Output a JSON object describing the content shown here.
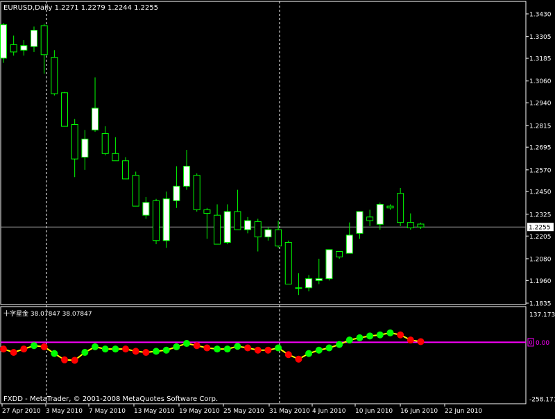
{
  "colors": {
    "background": "#000000",
    "frame": "#ffffff",
    "bull_candle": "#ffffff",
    "bear_candle": "#000000",
    "wick": "#00ff00",
    "indicator_line": "#ffff00",
    "dot_up": "#00ff00",
    "dot_down": "#ff0000",
    "zero_line": "#ff00ff",
    "price_line": "#a0a0a0",
    "badge_bg": "#ffffff",
    "badge_text": "#000000"
  },
  "price_panel": {
    "header": "EURUSD,Daily  1.2271 1.2279 1.2244 1.2255",
    "axis_labels": [
      "1.3430",
      "1.3305",
      "1.3185",
      "1.3060",
      "1.2940",
      "1.2815",
      "1.2695",
      "1.2570",
      "1.2450",
      "1.2325",
      "1.2205",
      "1.2080",
      "1.1960",
      "1.1835"
    ],
    "current_price_label": "1.2255"
  },
  "indicator_panel": {
    "header": "十字星金 38.07847 38.07847",
    "axis_labels": [
      "137.1737",
      "0.00",
      "-258.171"
    ],
    "zero_badge": "0"
  },
  "footer": {
    "copyright": "FXDD - MetaTrader, © 2001-2008 MetaQuotes Software Corp."
  },
  "time_axis": {
    "labels": [
      "27 Apr 2010",
      "3 May 2010",
      "7 May 2010",
      "13 May 2010",
      "19 May 2010",
      "25 May 2010",
      "31 May 2010",
      "4 Jun 2010",
      "10 Jun 2010",
      "16 Jun 2010",
      "22 Jun 2010"
    ]
  },
  "chart_data": [
    {
      "type": "candlestick",
      "title": "EURUSD,Daily",
      "ylim": [
        1.1835,
        1.343
      ],
      "candles": [
        {
          "o": 1.3186,
          "h": 1.338,
          "l": 1.316,
          "c": 1.337
        },
        {
          "o": 1.326,
          "h": 1.331,
          "l": 1.32,
          "c": 1.322
        },
        {
          "o": 1.323,
          "h": 1.3285,
          "l": 1.32,
          "c": 1.3255
        },
        {
          "o": 1.325,
          "h": 1.336,
          "l": 1.322,
          "c": 1.334
        },
        {
          "o": 1.3365,
          "h": 1.3375,
          "l": 1.31,
          "c": 1.3205
        },
        {
          "o": 1.319,
          "h": 1.323,
          "l": 1.298,
          "c": 1.299
        },
        {
          "o": 1.2995,
          "h": 1.3,
          "l": 1.281,
          "c": 1.281
        },
        {
          "o": 1.282,
          "h": 1.285,
          "l": 1.253,
          "c": 1.263
        },
        {
          "o": 1.264,
          "h": 1.279,
          "l": 1.257,
          "c": 1.274
        },
        {
          "o": 1.279,
          "h": 1.308,
          "l": 1.278,
          "c": 1.291
        },
        {
          "o": 1.277,
          "h": 1.281,
          "l": 1.265,
          "c": 1.266
        },
        {
          "o": 1.266,
          "h": 1.275,
          "l": 1.262,
          "c": 1.262
        },
        {
          "o": 1.262,
          "h": 1.264,
          "l": 1.252,
          "c": 1.252
        },
        {
          "o": 1.254,
          "h": 1.256,
          "l": 1.237,
          "c": 1.237
        },
        {
          "o": 1.232,
          "h": 1.242,
          "l": 1.23,
          "c": 1.239
        },
        {
          "o": 1.24,
          "h": 1.241,
          "l": 1.216,
          "c": 1.218
        },
        {
          "o": 1.218,
          "h": 1.245,
          "l": 1.214,
          "c": 1.241
        },
        {
          "o": 1.24,
          "h": 1.259,
          "l": 1.236,
          "c": 1.248
        },
        {
          "o": 1.248,
          "h": 1.268,
          "l": 1.246,
          "c": 1.259
        },
        {
          "o": 1.254,
          "h": 1.255,
          "l": 1.234,
          "c": 1.235
        },
        {
          "o": 1.235,
          "h": 1.236,
          "l": 1.219,
          "c": 1.233
        },
        {
          "o": 1.232,
          "h": 1.238,
          "l": 1.216,
          "c": 1.216
        },
        {
          "o": 1.217,
          "h": 1.238,
          "l": 1.216,
          "c": 1.234
        },
        {
          "o": 1.234,
          "h": 1.246,
          "l": 1.224,
          "c": 1.224
        },
        {
          "o": 1.224,
          "h": 1.231,
          "l": 1.222,
          "c": 1.229
        },
        {
          "o": 1.2285,
          "h": 1.23,
          "l": 1.212,
          "c": 1.22
        },
        {
          "o": 1.22,
          "h": 1.2255,
          "l": 1.218,
          "c": 1.224
        },
        {
          "o": 1.224,
          "h": 1.229,
          "l": 1.214,
          "c": 1.215
        },
        {
          "o": 1.217,
          "h": 1.218,
          "l": 1.194,
          "c": 1.194
        },
        {
          "o": 1.192,
          "h": 1.2,
          "l": 1.188,
          "c": 1.192
        },
        {
          "o": 1.192,
          "h": 1.199,
          "l": 1.19,
          "c": 1.197
        },
        {
          "o": 1.196,
          "h": 1.208,
          "l": 1.194,
          "c": 1.197
        },
        {
          "o": 1.197,
          "h": 1.213,
          "l": 1.196,
          "c": 1.213
        },
        {
          "o": 1.212,
          "h": 1.212,
          "l": 1.208,
          "c": 1.209
        },
        {
          "o": 1.211,
          "h": 1.228,
          "l": 1.211,
          "c": 1.221
        },
        {
          "o": 1.222,
          "h": 1.234,
          "l": 1.219,
          "c": 1.234
        },
        {
          "o": 1.231,
          "h": 1.235,
          "l": 1.226,
          "c": 1.229
        },
        {
          "o": 1.227,
          "h": 1.239,
          "l": 1.224,
          "c": 1.238
        },
        {
          "o": 1.237,
          "h": 1.238,
          "l": 1.235,
          "c": 1.236
        },
        {
          "o": 1.244,
          "h": 1.247,
          "l": 1.226,
          "c": 1.228
        },
        {
          "o": 1.228,
          "h": 1.233,
          "l": 1.224,
          "c": 1.225
        },
        {
          "o": 1.2271,
          "h": 1.2279,
          "l": 1.2244,
          "c": 1.2255
        }
      ],
      "current_price": 1.2255,
      "grid": false
    },
    {
      "type": "line",
      "title": "十字星金",
      "ylim": [
        -258.171,
        137.1737
      ],
      "zero_line": 0,
      "values": [
        -30,
        -45,
        -30,
        -15,
        -20,
        -50,
        -78,
        -80,
        -45,
        -20,
        -30,
        -30,
        -30,
        -40,
        -45,
        -40,
        -35,
        -20,
        -5,
        -15,
        -25,
        -30,
        -30,
        -18,
        -25,
        -35,
        -35,
        -25,
        -55,
        -75,
        -50,
        -35,
        -25,
        -10,
        10,
        20,
        28,
        33,
        42,
        33,
        10,
        3
      ],
      "dot_colors": [
        "r",
        "r",
        "r",
        "g",
        "r",
        "g",
        "r",
        "r",
        "g",
        "g",
        "g",
        "g",
        "r",
        "r",
        "r",
        "g",
        "g",
        "g",
        "g",
        "r",
        "r",
        "g",
        "g",
        "g",
        "r",
        "r",
        "r",
        "g",
        "r",
        "r",
        "g",
        "g",
        "g",
        "g",
        "g",
        "g",
        "g",
        "g",
        "g",
        "r",
        "r",
        "r"
      ],
      "grid": false
    }
  ]
}
